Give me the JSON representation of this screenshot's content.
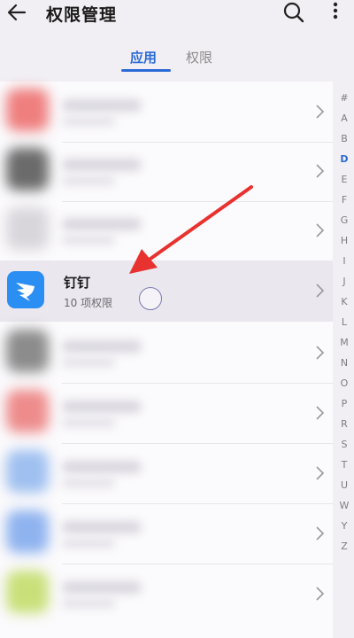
{
  "header": {
    "back_icon": "arrow-left-icon",
    "title": "权限管理",
    "search_icon": "search-icon",
    "more_icon": "more-vertical-icon"
  },
  "tabs": [
    {
      "label": "应用",
      "active": true
    },
    {
      "label": "权限",
      "active": false
    }
  ],
  "list": {
    "highlighted_app": {
      "name": "钉钉",
      "subtitle": "10 项权限",
      "icon": "dingtalk-logo-icon",
      "icon_color": "#2b8ef2"
    },
    "blurred_row_colors": [
      "#ef7f7f",
      "#6b6b6b",
      "#d8d6db",
      "#8c8c8c",
      "#ee8c8c",
      "#9fc0f0",
      "#8fb3ef",
      "#c9e07a"
    ]
  },
  "index_letters": [
    "#",
    "A",
    "B",
    "D",
    "E",
    "F",
    "G",
    "H",
    "I",
    "J",
    "K",
    "L",
    "M",
    "N",
    "O",
    "P",
    "R",
    "S",
    "T",
    "U",
    "W",
    "Y",
    "Z"
  ],
  "index_active": "D",
  "colors": {
    "accent": "#2a6ad6",
    "annotation_arrow": "#e8322f"
  }
}
